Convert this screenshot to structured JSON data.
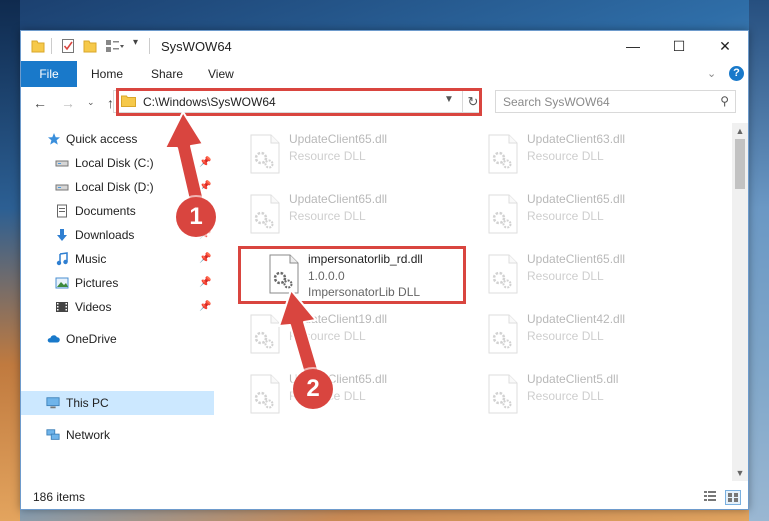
{
  "window": {
    "title": "SysWOW64",
    "controls": {
      "minimize": "—",
      "maximize": "☐",
      "close": "✕"
    }
  },
  "ribbon": {
    "tabs": [
      {
        "label": "File"
      },
      {
        "label": "Home"
      },
      {
        "label": "Share"
      },
      {
        "label": "View"
      }
    ],
    "help": "?"
  },
  "navigation": {
    "address": "C:\\Windows\\SysWOW64",
    "search_placeholder": "Search SysWOW64"
  },
  "sidebar": {
    "items": [
      {
        "label": "Quick access",
        "icon": "star-icon"
      },
      {
        "label": "Local Disk (C:)",
        "icon": "drive-icon"
      },
      {
        "label": "Local Disk (D:)",
        "icon": "drive-icon"
      },
      {
        "label": "Documents",
        "icon": "documents-icon"
      },
      {
        "label": "Downloads",
        "icon": "download-icon"
      },
      {
        "label": "Music",
        "icon": "music-icon"
      },
      {
        "label": "Pictures",
        "icon": "pictures-icon"
      },
      {
        "label": "Videos",
        "icon": "videos-icon"
      },
      {
        "label": "OneDrive",
        "icon": "cloud-icon"
      },
      {
        "label": "This PC",
        "icon": "computer-icon"
      },
      {
        "label": "Network",
        "icon": "network-icon"
      }
    ]
  },
  "files": {
    "left": [
      {
        "name": "UpdateClient65.dll",
        "desc": "Resource DLL"
      },
      {
        "name": "UpdateClient65.dll",
        "desc": "Resource DLL"
      },
      {
        "name": "impersonatorlib_rd.dll",
        "desc": "1.0.0.0",
        "extra": "ImpersonatorLib DLL"
      },
      {
        "name": "UpdateClient19.dll",
        "desc": "Resource DLL"
      },
      {
        "name": "UpdateClient65.dll",
        "desc": "Resource DLL"
      }
    ],
    "right": [
      {
        "name": "UpdateClient63.dll",
        "desc": "Resource DLL"
      },
      {
        "name": "UpdateClient65.dll",
        "desc": "Resource DLL"
      },
      {
        "name": "UpdateClient65.dll",
        "desc": "Resource DLL"
      },
      {
        "name": "UpdateClient42.dll",
        "desc": "Resource DLL"
      },
      {
        "name": "UpdateClient5.dll",
        "desc": "Resource DLL"
      }
    ]
  },
  "status": {
    "count": "186 items"
  },
  "annotations": {
    "step1": "1",
    "step2": "2"
  },
  "colors": {
    "accent": "#1979ca",
    "highlight": "#d9453f",
    "selected": "#cce8ff"
  }
}
